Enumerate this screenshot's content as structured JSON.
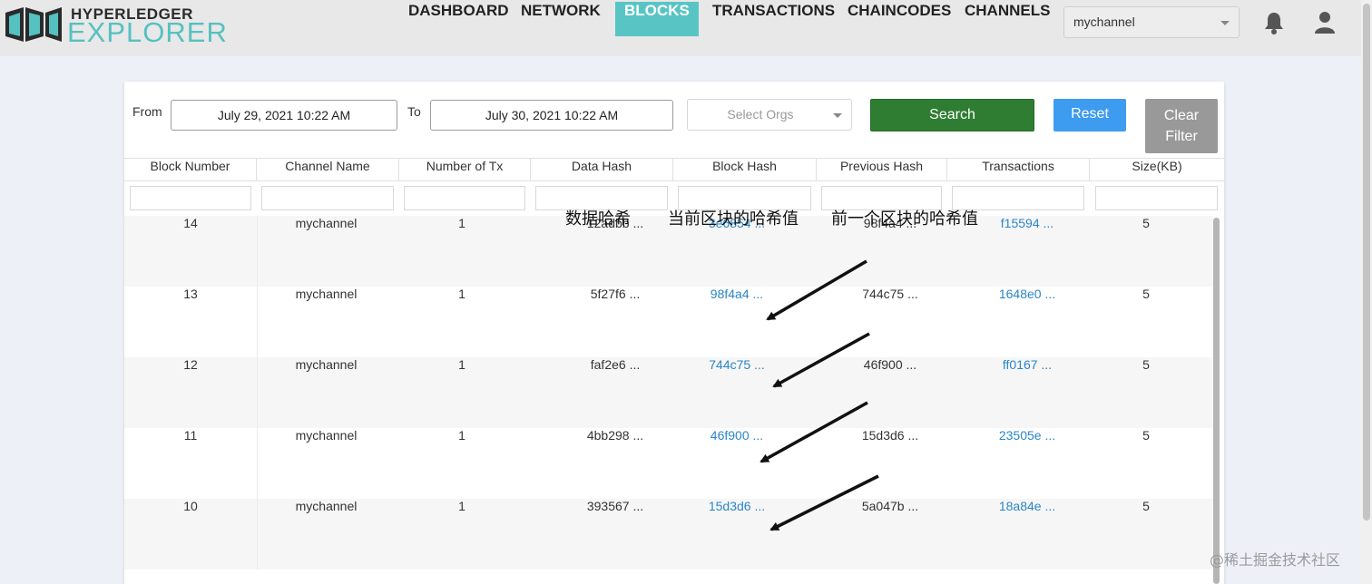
{
  "header": {
    "logo_top": "HYPERLEDGER",
    "logo_bottom": "EXPLORER",
    "nav": [
      "DASHBOARD",
      "NETWORK",
      "BLOCKS",
      "TRANSACTIONS",
      "CHAINCODES",
      "CHANNELS"
    ],
    "active_nav": "BLOCKS",
    "channel": "mychannel",
    "icons": [
      "bell-icon",
      "user-icon"
    ]
  },
  "filters": {
    "from_label": "From",
    "from_value": "July 29, 2021 10:22 AM",
    "to_label": "To",
    "to_value": "July 30, 2021 10:22 AM",
    "orgs_placeholder": "Select Orgs",
    "search_label": "Search",
    "reset_label": "Reset",
    "clear_label_1": "Clear",
    "clear_label_2": "Filter"
  },
  "table": {
    "columns": [
      "Block Number",
      "Channel Name",
      "Number of Tx",
      "Data Hash",
      "Block Hash",
      "Previous Hash",
      "Transactions",
      "Size(KB)"
    ],
    "rows": [
      {
        "block": "14",
        "channel": "mychannel",
        "tx": "1",
        "data_hash": "12adbb ...",
        "block_hash": "3e6854 ...",
        "prev_hash": "98f4a4 ...",
        "transactions": "f15594 ...",
        "size": "5"
      },
      {
        "block": "13",
        "channel": "mychannel",
        "tx": "1",
        "data_hash": "5f27f6 ...",
        "block_hash": "98f4a4 ...",
        "prev_hash": "744c75 ...",
        "transactions": "1648e0 ...",
        "size": "5"
      },
      {
        "block": "12",
        "channel": "mychannel",
        "tx": "1",
        "data_hash": "faf2e6 ...",
        "block_hash": "744c75 ...",
        "prev_hash": "46f900 ...",
        "transactions": "ff0167 ...",
        "size": "5"
      },
      {
        "block": "11",
        "channel": "mychannel",
        "tx": "1",
        "data_hash": "4bb298 ...",
        "block_hash": "46f900 ...",
        "prev_hash": "15d3d6 ...",
        "transactions": "23505e ...",
        "size": "5"
      },
      {
        "block": "10",
        "channel": "mychannel",
        "tx": "1",
        "data_hash": "393567 ...",
        "block_hash": "15d3d6 ...",
        "prev_hash": "5a047b ...",
        "transactions": "18a84e ...",
        "size": "5"
      }
    ]
  },
  "annotations": {
    "data_hash": "数据哈希",
    "block_hash": "当前区块的哈希值",
    "prev_hash": "前一个区块的哈希值"
  },
  "watermark": "@稀土掘金技术社区",
  "colors": {
    "accent": "#58c5c4",
    "search": "#2f7d32",
    "reset": "#3d9bf0",
    "clear": "#999999",
    "link": "#2a86c9"
  }
}
